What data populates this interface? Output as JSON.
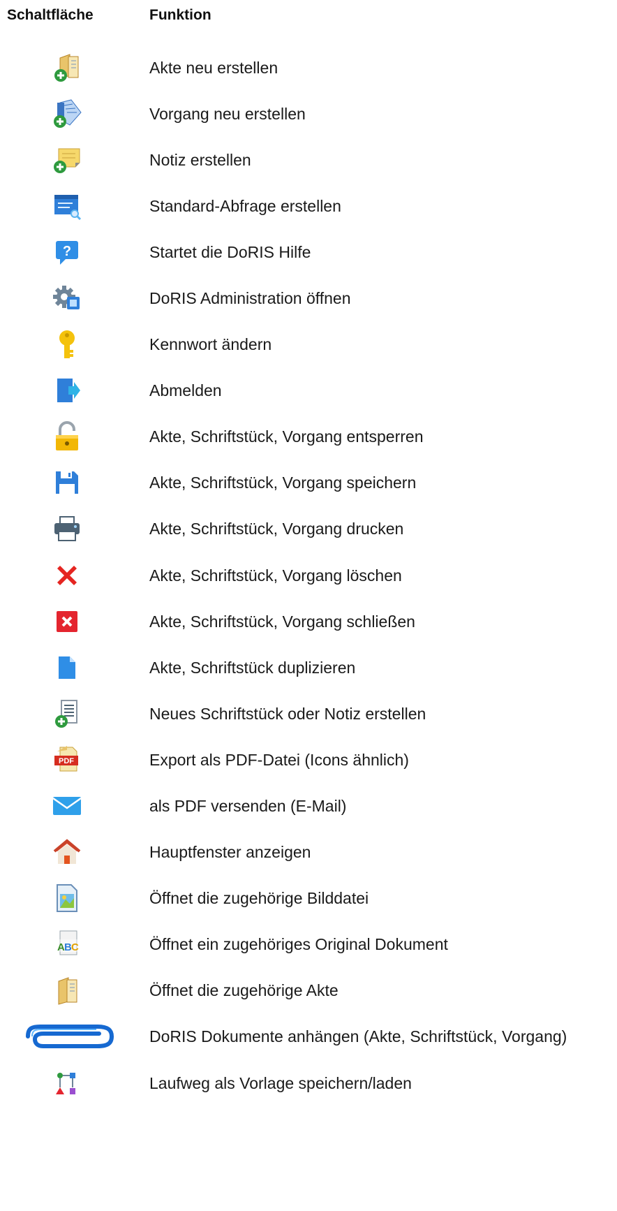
{
  "table": {
    "header_button": "Schaltfläche",
    "header_function": "Funktion",
    "rows": [
      {
        "icon": "folder-add-icon",
        "label": "Akte neu erstellen"
      },
      {
        "icon": "process-add-icon",
        "label": "Vorgang neu erstellen"
      },
      {
        "icon": "note-add-icon",
        "label": "Notiz erstellen"
      },
      {
        "icon": "query-search-icon",
        "label": "Standard-Abfrage erstellen"
      },
      {
        "icon": "help-icon",
        "label": "Startet die DoRIS Hilfe"
      },
      {
        "icon": "admin-gear-icon",
        "label": "DoRIS Administration öffnen"
      },
      {
        "icon": "key-icon",
        "label": "Kennwort ändern"
      },
      {
        "icon": "logout-icon",
        "label": "Abmelden"
      },
      {
        "icon": "unlock-icon",
        "label": "Akte, Schriftstück, Vorgang entsperren"
      },
      {
        "icon": "save-icon",
        "label": "Akte, Schriftstück, Vorgang speichern"
      },
      {
        "icon": "print-icon",
        "label": "Akte, Schriftstück, Vorgang drucken"
      },
      {
        "icon": "delete-icon",
        "label": "Akte, Schriftstück, Vorgang löschen"
      },
      {
        "icon": "close-icon",
        "label": "Akte, Schriftstück, Vorgang schließen"
      },
      {
        "icon": "duplicate-icon",
        "label": "Akte, Schriftstück duplizieren"
      },
      {
        "icon": "document-add-icon",
        "label": "Neues Schriftstück oder Notiz erstellen"
      },
      {
        "icon": "pdf-export-icon",
        "label": "Export als PDF-Datei (Icons ähnlich)"
      },
      {
        "icon": "mail-icon",
        "label": "als PDF versenden (E-Mail)"
      },
      {
        "icon": "home-icon",
        "label": "Hauptfenster anzeigen"
      },
      {
        "icon": "image-file-icon",
        "label": "Öffnet die zugehörige Bilddatei"
      },
      {
        "icon": "original-document-icon",
        "label": "Öffnet ein zugehöriges Original Dokument"
      },
      {
        "icon": "folder-open-icon",
        "label": "Öffnet die zugehörige Akte"
      },
      {
        "icon": "paperclip-icon",
        "label": "DoRIS Dokumente anhängen (Akte, Schriftstück, Vorgang)"
      },
      {
        "icon": "workflow-icon",
        "label": "Laufweg als Vorlage speichern/laden"
      }
    ]
  }
}
